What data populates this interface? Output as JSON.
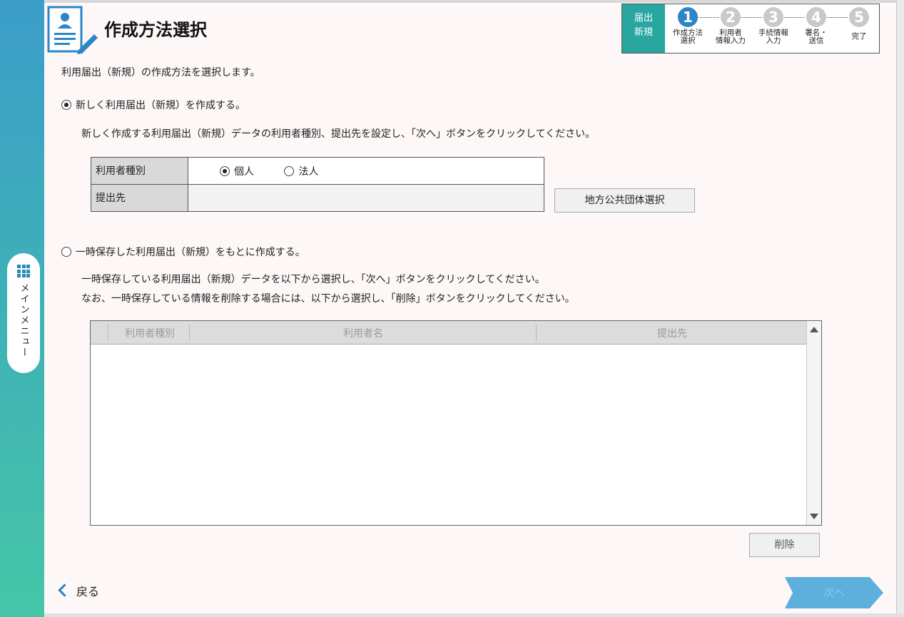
{
  "page": {
    "title": "作成方法選択"
  },
  "side_menu": {
    "label": "メインメニュー"
  },
  "steps": {
    "badge": "届出\n新規",
    "items": [
      {
        "num": "1",
        "label": "作成方法\n選択",
        "active": true
      },
      {
        "num": "2",
        "label": "利用者\n情報入力",
        "active": false
      },
      {
        "num": "3",
        "label": "手続情報\n入力",
        "active": false
      },
      {
        "num": "4",
        "label": "署名・\n送信",
        "active": false
      },
      {
        "num": "5",
        "label": "完了",
        "active": false
      }
    ]
  },
  "intro": "利用届出（新規）の作成方法を選択します。",
  "option_new": {
    "label": "新しく利用届出（新規）を作成する。",
    "selected": true,
    "description": "新しく作成する利用届出（新規）データの利用者種別、提出先を設定し、「次へ」ボタンをクリックしてください。",
    "user_type_label": "利用者種別",
    "user_type_options": [
      {
        "label": "個人",
        "selected": true
      },
      {
        "label": "法人",
        "selected": false
      }
    ],
    "destination_label": "提出先",
    "destination_value": "",
    "select_button": "地方公共団体選択"
  },
  "option_saved": {
    "label": "一時保存した利用届出（新規）をもとに作成する。",
    "selected": false,
    "description_1": "一時保存している利用届出（新規）データを以下から選択し、「次へ」ボタンをクリックしてください。",
    "description_2": "なお、一時保存している情報を削除する場合には、以下から選択し、「削除」ボタンをクリックしてください。",
    "columns": [
      "利用者種別",
      "利用者名",
      "提出先"
    ],
    "rows": [],
    "delete_button": "削除"
  },
  "footer": {
    "back": "戻る",
    "next": "次へ"
  },
  "colors": {
    "accent": "#2a86c8",
    "badge": "#2aa6a0"
  }
}
